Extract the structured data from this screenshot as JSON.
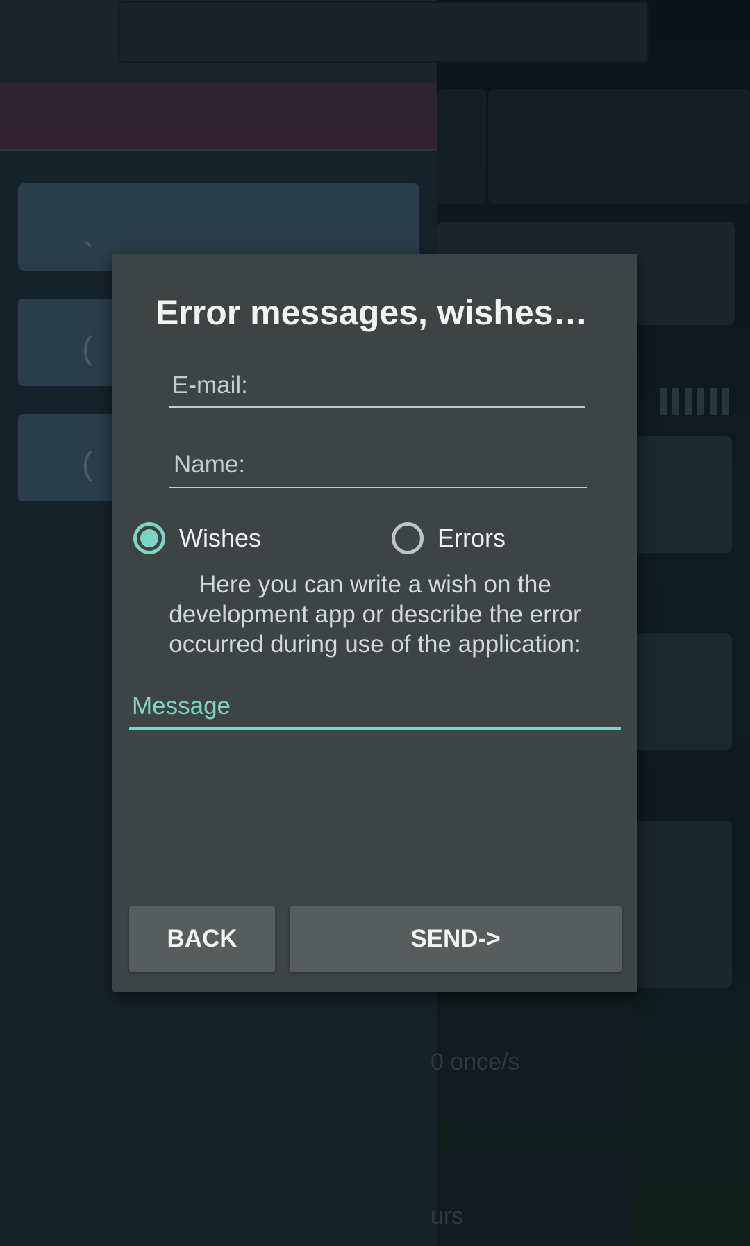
{
  "dialog": {
    "title": "Error messages, wishes…",
    "email_placeholder": "E-mail:",
    "name_placeholder": "Name:",
    "radio_options": [
      {
        "label": "Wishes",
        "checked": true
      },
      {
        "label": "Errors",
        "checked": false
      }
    ],
    "info_text": "Here you can write a wish on the development app or describe the error occurred during use of the application:",
    "message_placeholder": "Message",
    "back_label": "BACK",
    "send_label": "SEND->"
  },
  "background": {
    "glyph_1": "`",
    "glyph_2": "(",
    "glyph_3": "(",
    "text_1": "0 once/s",
    "text_2": "urs"
  },
  "colors": {
    "accent": "#7dd3c6",
    "dialog_bg": "#3e4444",
    "button_bg": "#575d5d"
  }
}
